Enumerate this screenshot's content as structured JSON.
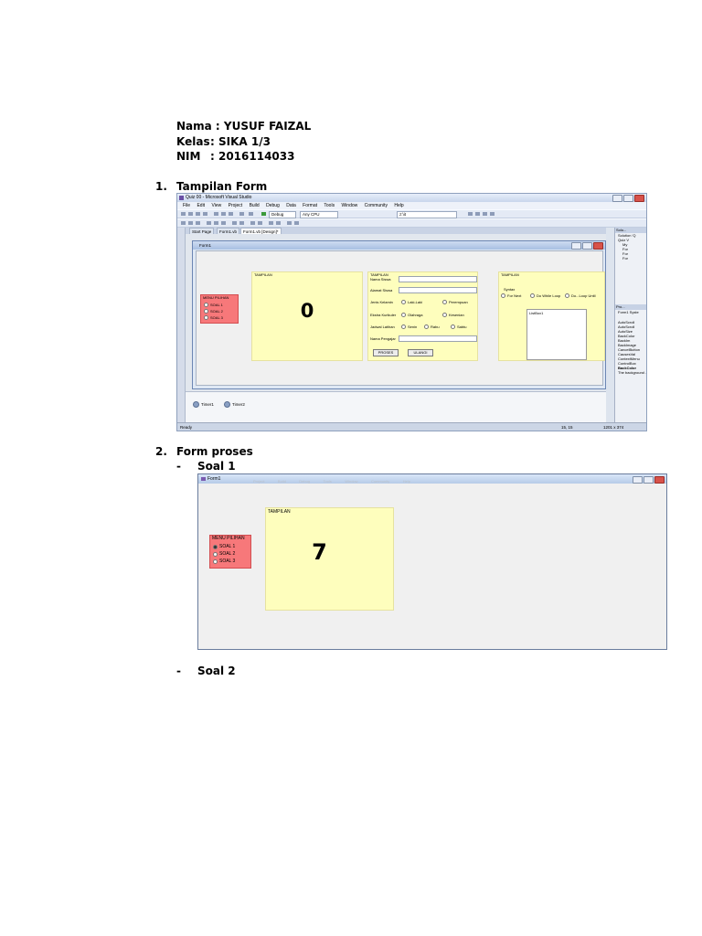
{
  "header": {
    "nama_label": "Nama :",
    "nama_value": "YUSUF FAIZAL",
    "kelas_label": "Kelas",
    "kelas_value": ": SIKA 1/3",
    "nim_label": "NIM",
    "nim_value": ": 2016114033"
  },
  "sections": [
    {
      "number": "1.",
      "title": "Tampilan Form"
    },
    {
      "number": "2.",
      "title": "Form proses"
    }
  ],
  "subsections": [
    {
      "bullet": "-",
      "title": "Soal 1"
    },
    {
      "bullet": "-",
      "title": "Soal 2"
    }
  ],
  "vs_window": {
    "title": "Quiz 00 - Microsoft Visual Studio",
    "menu": [
      "File",
      "Edit",
      "View",
      "Project",
      "Build",
      "Debug",
      "Data",
      "Format",
      "Tools",
      "Window",
      "Community",
      "Help"
    ],
    "toolbar": {
      "config": "Debug",
      "platform": "Any CPU",
      "search": "z:\\it"
    },
    "tabs": [
      "Start Page",
      "Form1.vb",
      "Form1.vb [Design]*"
    ],
    "status_left": "Ready",
    "status_pos": "15, 15",
    "status_size": "1201 x 374",
    "tray": [
      "Timer1",
      "Timer2"
    ],
    "right_panel": {
      "solution_title": "Solu...",
      "solution_items": [
        "Solution 'Q",
        "Quiz V",
        "My",
        "For",
        "For",
        "For"
      ],
      "properties_title": "Pro...",
      "properties_object": "Form1 Syste",
      "properties_rows": [
        "AutoScroll",
        "AutoScroll",
        "AutoSize",
        "BackColor",
        "BackIm",
        "BackImage",
        "CancelButton",
        "CausesVal",
        "ContextMenu",
        "ControlBox"
      ],
      "desc_title": "BackColor",
      "desc_text": "The background ..."
    }
  },
  "design_form": {
    "title": "Form1",
    "menu_group": {
      "title": "MENU PILIHAN",
      "options": [
        "SOAL 1",
        "SOAL 2",
        "SOAL 3"
      ]
    },
    "tampilan_panel": {
      "title": "TAMPILAN",
      "value": "0"
    },
    "student_panel": {
      "title": "TAMPILAN",
      "fields": [
        "Nama Siswa",
        "Alamat Siswa",
        "Jenis Kelamin",
        "Ekstra Kurikuler",
        "Jadwal Latihan",
        "Nama Pengajar"
      ],
      "gender_options": [
        "Laki-Laki",
        "Perempuan"
      ],
      "ekskul_options": [
        "Olahraga",
        "Kesenian"
      ],
      "jadwal_options": [
        "Senin",
        "Rabu",
        "Sabtu"
      ],
      "buttons": [
        "PROSES",
        "ULANGI"
      ]
    },
    "loop_panel": {
      "title": "TAMPILAN",
      "syntax_label": "Syntax",
      "options": [
        "For Next",
        "Do While Loop",
        "Do...Loop Until"
      ],
      "listbox_label": "ListBox1"
    }
  },
  "runtime_form": {
    "title": "Form1",
    "faint_menu": [
      "Project",
      "Build",
      "Debug",
      "Tools",
      "Window",
      "Community",
      "Help"
    ],
    "menu_group": {
      "title": "MENU PILIHAN",
      "options": [
        "SOAL 1",
        "SOAL 2",
        "SOAL 3"
      ]
    },
    "tampilan_panel": {
      "title": "TAMPILAN",
      "value": "7"
    }
  },
  "colors": {
    "yellow_panel": "#fefebd",
    "red_panel": "#f7787a",
    "vs_chrome": "#dde4ee"
  }
}
